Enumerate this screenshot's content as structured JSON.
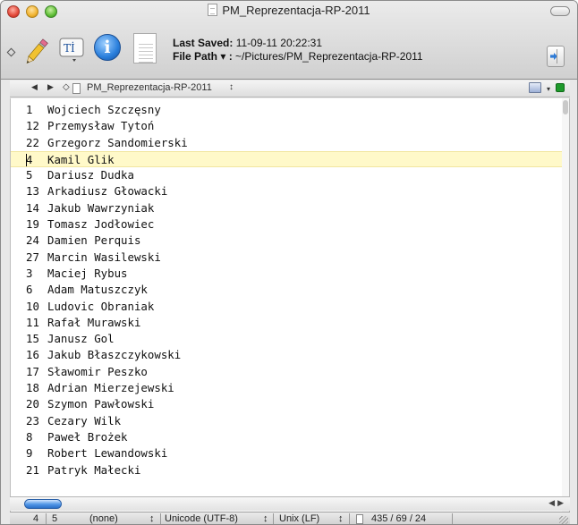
{
  "window": {
    "title": "PM_Reprezentacja-RP-2011"
  },
  "toolbar": {
    "last_saved_label": "Last Saved:",
    "last_saved_value": "11-09-11 20:22:31",
    "file_path_label": "File Path ▾ :",
    "file_path_value": "~/Pictures/PM_Reprezentacja-RP-2011",
    "text_button_glyph": "Tİ",
    "info_button_glyph": "i"
  },
  "navbar": {
    "back": "◀",
    "forward": "▶",
    "diamond": "◇",
    "document_name": "PM_Reprezentacja-RP-2011",
    "updown": "↕",
    "book_chevron": "▾"
  },
  "editor": {
    "current_line_index": 3,
    "lines": [
      {
        "num": "1",
        "name": "Wojciech Szczęsny"
      },
      {
        "num": "12",
        "name": "Przemysław Tytoń"
      },
      {
        "num": "22",
        "name": "Grzegorz Sandomierski"
      },
      {
        "num": "4",
        "name": "Kamil Glik"
      },
      {
        "num": "5",
        "name": "Dariusz Dudka"
      },
      {
        "num": "13",
        "name": "Arkadiusz Głowacki"
      },
      {
        "num": "14",
        "name": "Jakub Wawrzyniak"
      },
      {
        "num": "19",
        "name": "Tomasz Jodłowiec"
      },
      {
        "num": "24",
        "name": "Damien Perquis"
      },
      {
        "num": "27",
        "name": "Marcin Wasilewski"
      },
      {
        "num": "3",
        "name": "Maciej Rybus"
      },
      {
        "num": "6",
        "name": "Adam Matuszczyk"
      },
      {
        "num": "10",
        "name": "Ludovic Obraniak"
      },
      {
        "num": "11",
        "name": "Rafał Murawski"
      },
      {
        "num": "15",
        "name": "Janusz Gol"
      },
      {
        "num": "16",
        "name": "Jakub Błaszczykowski"
      },
      {
        "num": "17",
        "name": "Sławomir Peszko"
      },
      {
        "num": "18",
        "name": "Adrian Mierzejewski"
      },
      {
        "num": "20",
        "name": "Szymon Pawłowski"
      },
      {
        "num": "23",
        "name": "Cezary Wilk"
      },
      {
        "num": "8",
        "name": "Paweł Brożek"
      },
      {
        "num": "9",
        "name": "Robert Lewandowski"
      },
      {
        "num": "21",
        "name": "Patryk Małecki"
      }
    ]
  },
  "hscroll": {
    "arrows": "◀▶"
  },
  "status": {
    "line": "4",
    "column": "5",
    "syntax": "(none)",
    "syntax_arrow": "↕",
    "encoding": "Unicode (UTF-8)",
    "encoding_arrow": "↕",
    "line_endings": "Unix (LF)",
    "line_endings_arrow": "↕",
    "counts": "435 / 69 / 24"
  },
  "colors": {
    "current_line_highlight": "#fff9c9",
    "accent_blue": "#2a7fdc"
  }
}
